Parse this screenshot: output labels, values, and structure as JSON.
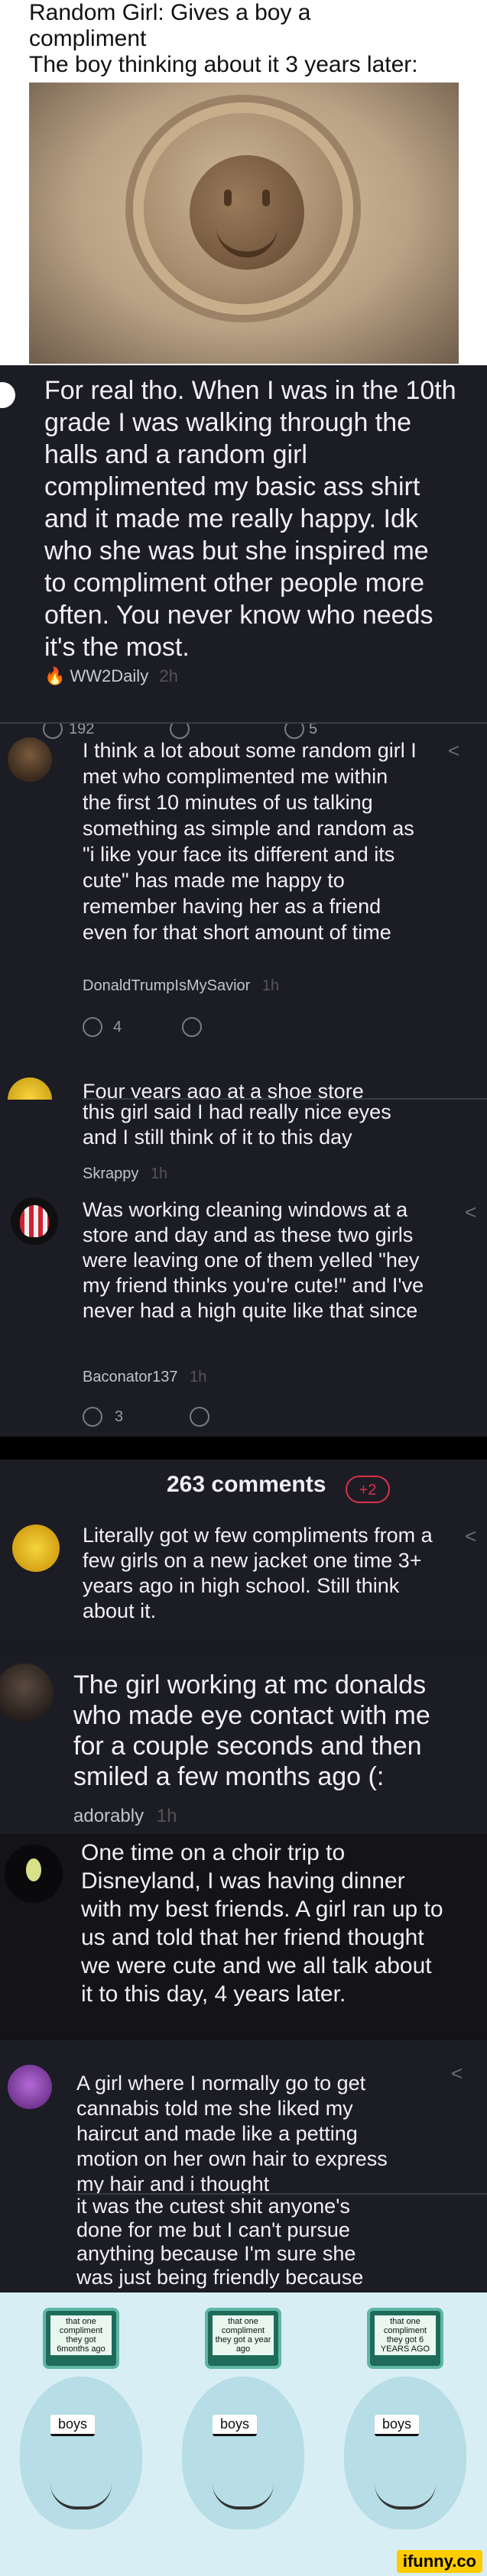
{
  "meme": {
    "line1": "Random Girl: Gives a boy a",
    "line2": "compliment",
    "line3": "The boy thinking about it 3 years later:"
  },
  "post1": {
    "text": "For real tho. When I was in the 10th grade I was walking through the halls and a random girl complimented my basic ass shirt and it made me really happy. Idk who she was but she inspired me to compliment other people more often. You never know who needs it's the most.",
    "author": "WW2Daily",
    "time": "2h",
    "upvotes": "192",
    "replies": "5"
  },
  "comment1": {
    "text": "I think a lot about some random girl I met who complimented me within the first 10 minutes of us talking something as simple and random as \"i like your face its different and its cute\" has made me happy to remember having her as a friend even for that short amount of time",
    "author": "DonaldTrumpIsMySavior",
    "time": "1h",
    "likes": "4"
  },
  "comment2": {
    "line1": "Four years ago at a shoe store",
    "text": "this girl said I had really nice eyes and I still think of it to this day",
    "author": "Skrappy",
    "time": "1h"
  },
  "comment3": {
    "text": "Was working cleaning windows at a store and day and as these two girls were leaving one of them yelled \"hey my friend thinks you're cute!\" and I've never had a high quite like that since",
    "author": "Baconator137",
    "time": "1h",
    "likes": "3"
  },
  "comments_header": {
    "label": "263 comments",
    "badge": "+2"
  },
  "comment4": {
    "text": "Literally got w few compliments from a few girls on a new jacket one time 3+ years ago in high school. Still think about it."
  },
  "comment5": {
    "text": "The girl working at mc donalds who made eye contact with me for a couple seconds and then smiled a few months ago (:",
    "author": "adorably",
    "time": "1h"
  },
  "comment6": {
    "text": "One time on a choir trip to Disneyland, I was having dinner with my best friends. A girl ran up to us and told that her friend thought we were cute and we all talk about it to this day, 4 years later."
  },
  "comment7": {
    "text": "A girl where I normally go to get cannabis told me she liked my haircut and made like a petting motion on her own hair to express my hair and i thought",
    "text_cont": "it was the cutest shit anyone's done for me but I can't pursue anything because I'm sure she was just being friendly because she's working"
  },
  "final_meme": {
    "panels": [
      {
        "sign": "that one compliment they got 6months ago",
        "label": "boys"
      },
      {
        "sign": "that one compliment they got a year ago",
        "label": "boys"
      },
      {
        "sign": "that one compliment they got 6 YEARS AGO",
        "label": "boys"
      }
    ],
    "watermark": "ifunny.co"
  }
}
